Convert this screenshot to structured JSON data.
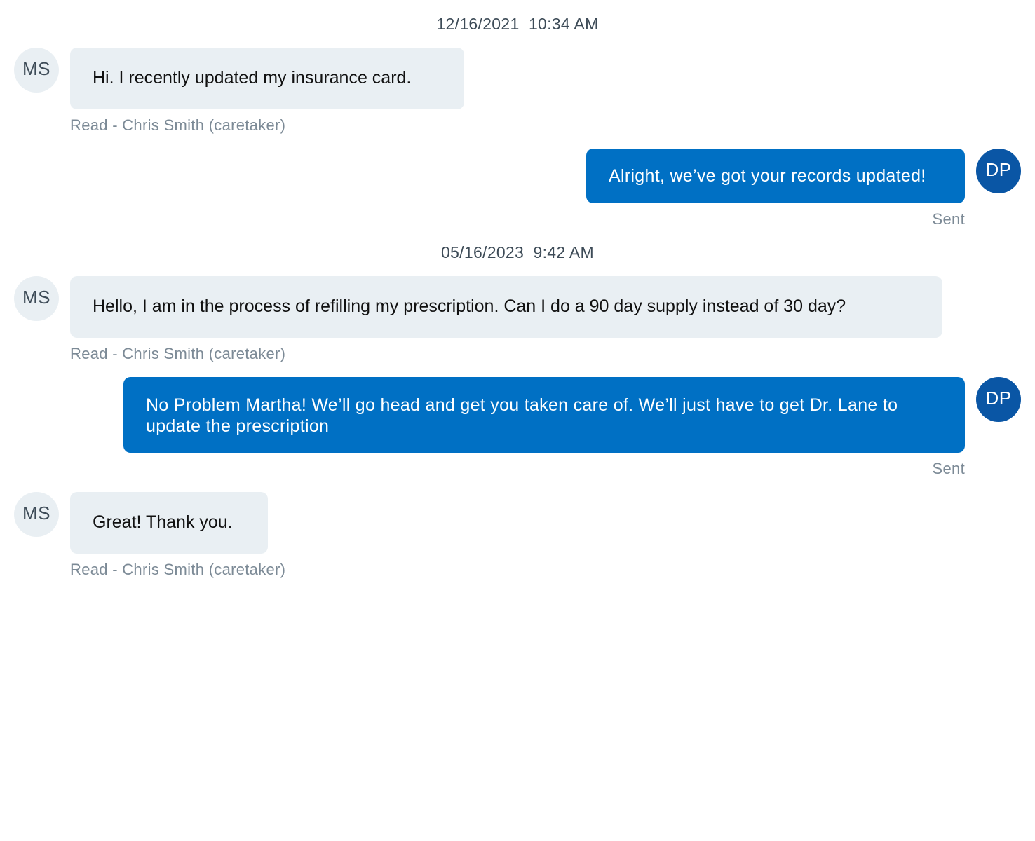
{
  "thread": {
    "timestamps": [
      "12/16/2021  10:34 AM",
      "05/16/2023  9:42 AM"
    ],
    "messages": [
      {
        "sender": "patient",
        "initials": "MS",
        "text": "Hi. I recently updated my insurance card.",
        "status": "Read - Chris Smith (caretaker)"
      },
      {
        "sender": "staff",
        "initials": "DP",
        "text": "Alright, we’ve got your records updated!",
        "status": "Sent"
      },
      {
        "sender": "patient",
        "initials": "MS",
        "text": "Hello, I am in the process of refilling my prescription. Can I do a 90 day supply instead of 30 day?",
        "status": "Read - Chris Smith (caretaker)"
      },
      {
        "sender": "staff",
        "initials": "DP",
        "text": "No Problem Martha! We’ll go head and get you taken care of. We’ll just have to get Dr. Lane to update the prescription",
        "status": "Sent"
      },
      {
        "sender": "patient",
        "initials": "MS",
        "text": "Great! Thank you.",
        "status": "Read - Chris Smith (caretaker)"
      }
    ]
  },
  "colors": {
    "incoming_bubble": "#e9eff3",
    "outgoing_bubble": "#0070c4",
    "staff_avatar": "#0a56a5",
    "status_text": "#7c8a96"
  }
}
